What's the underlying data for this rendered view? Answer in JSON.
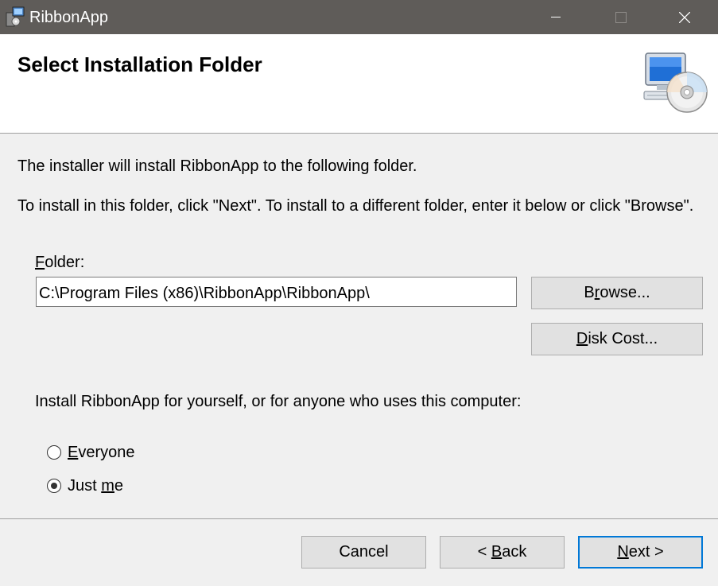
{
  "window": {
    "title": "RibbonApp",
    "controls": [
      "minimize-icon",
      "maximize-icon",
      "close-icon"
    ]
  },
  "header": {
    "title": "Select Installation Folder",
    "icon": "computer-cd-icon"
  },
  "body": {
    "intro_line1": "The installer will install RibbonApp to the following folder.",
    "intro_line2": "To install in this folder, click \"Next\". To install to a different folder, enter it below or click \"Browse\".",
    "folder_label_key": "F",
    "folder_label_rest": "older:",
    "folder_value": "C:\\Program Files (x86)\\RibbonApp\\RibbonApp\\",
    "browse_pre": "B",
    "browse_key": "r",
    "browse_post": "owse...",
    "diskcost_key": "D",
    "diskcost_post": "isk Cost...",
    "install_for_text": "Install RibbonApp for yourself, or for anyone who uses this computer:",
    "radio_options": [
      {
        "key": "E",
        "rest": "veryone",
        "selected": false
      },
      {
        "pre": "Just ",
        "key": "m",
        "rest": "e",
        "selected": true
      }
    ]
  },
  "footer": {
    "cancel_label": "Cancel",
    "back_pre": "< ",
    "back_key": "B",
    "back_post": "ack",
    "next_key": "N",
    "next_post": "ext >"
  },
  "colors": {
    "titlebar": "#5f5c59",
    "dialog_bg": "#f0f0f0",
    "button_bg": "#e1e1e1",
    "default_button_border": "#0078d7"
  }
}
